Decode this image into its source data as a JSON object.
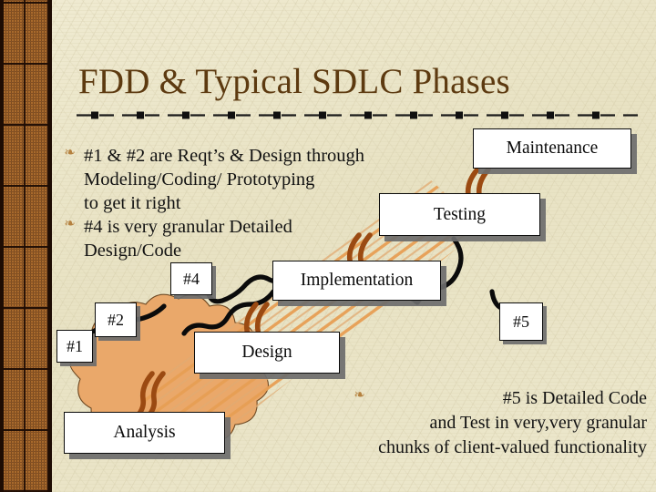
{
  "slide": {
    "title": "FDD & Typical SDLC Phases",
    "background_color": "#ebe6ca",
    "title_color": "#5d3a10",
    "accent_color": "#e0a05a",
    "band_color": "#7a4a22"
  },
  "bullets_left": [
    {
      "bullet_icon": "floret-bullet-icon",
      "lines": [
        "#1 & #2 are Reqt’s & Design through",
        "Modeling/Coding/ Prototyping",
        "to get it right"
      ]
    },
    {
      "bullet_icon": "floret-bullet-icon",
      "lines": [
        "#4 is very granular Detailed",
        "Design/Code"
      ]
    }
  ],
  "bullets_right": [
    {
      "bullet_icon": "floret-bullet-icon",
      "lines": [
        "#5 is Detailed Code",
        "and Test in very,very granular",
        "chunks of client-valued functionality"
      ]
    }
  ],
  "phase_boxes": [
    {
      "id": "maintenance",
      "label": "Maintenance"
    },
    {
      "id": "testing",
      "label": "Testing"
    },
    {
      "id": "implementation",
      "label": "Implementation"
    },
    {
      "id": "design",
      "label": "Design"
    },
    {
      "id": "analysis",
      "label": "Analysis"
    }
  ],
  "step_markers": [
    {
      "id": "step-1",
      "label": "#1"
    },
    {
      "id": "step-2",
      "label": "#2"
    },
    {
      "id": "step-4",
      "label": "#4"
    },
    {
      "id": "step-5",
      "label": "#5"
    }
  ],
  "decorations": {
    "title_rule": "dash-dot-rule",
    "cloud": "analysis-cloud-shape",
    "arrow_band": "orange-arrow-band",
    "connector": "black-zigzag-connector",
    "squiggles": "brown-double-squiggle"
  }
}
